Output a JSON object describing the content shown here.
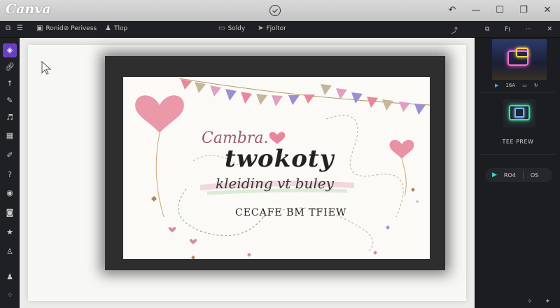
{
  "app": {
    "logo": "Canva"
  },
  "toolbar": {
    "project_name": "Ronid⊘ Perivess",
    "item2": "Tlop",
    "center_left": "Soldy",
    "center_right": "Fjoltor",
    "right_item": "Fᴉ"
  },
  "left_tools": [
    "select",
    "link",
    "upload",
    "pen",
    "music",
    "layout",
    "brush",
    "help",
    "shapes",
    "camera",
    "star",
    "person",
    "user",
    "grid"
  ],
  "card": {
    "line1": "Cambra.",
    "line2": "twokoty",
    "line3": "kleiding vt buley",
    "line4": "CECAFE BM TFIEW",
    "colors": {
      "heart": "#e8869b",
      "bunting": [
        "#e8869b",
        "#9a8fcf",
        "#c4b59c",
        "#e0a0c0"
      ]
    }
  },
  "right_panel": {
    "mini_row": {
      "label": "16A"
    },
    "thumb2_label": "TEE PREW",
    "controls": {
      "left_label": "RO4",
      "right_label": "OS"
    }
  }
}
